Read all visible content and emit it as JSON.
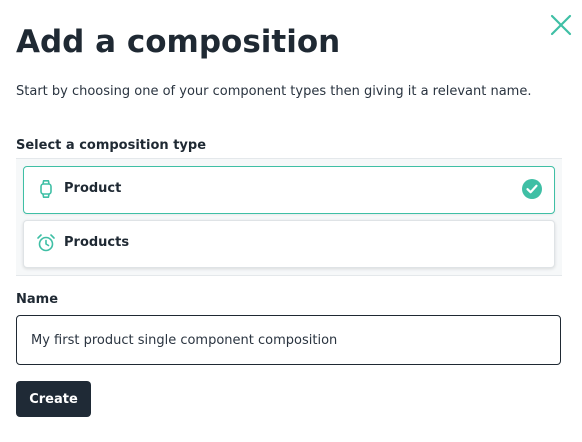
{
  "dialog": {
    "title": "Add a composition",
    "subtitle": "Start by choosing one of your component types then giving it a relevant name.",
    "close_icon": "close-icon",
    "accent_color": "#3fbfa5"
  },
  "type_section": {
    "label": "Select a composition type",
    "items": [
      {
        "label": "Product",
        "icon": "watch-icon",
        "selected": true
      },
      {
        "label": "Products",
        "icon": "alarm-clock-icon",
        "selected": false
      }
    ],
    "selected_icon": "check-circle-icon"
  },
  "name_section": {
    "label": "Name",
    "value": "My first product single component composition"
  },
  "actions": {
    "create_label": "Create",
    "create_color": "#1f2a36"
  }
}
